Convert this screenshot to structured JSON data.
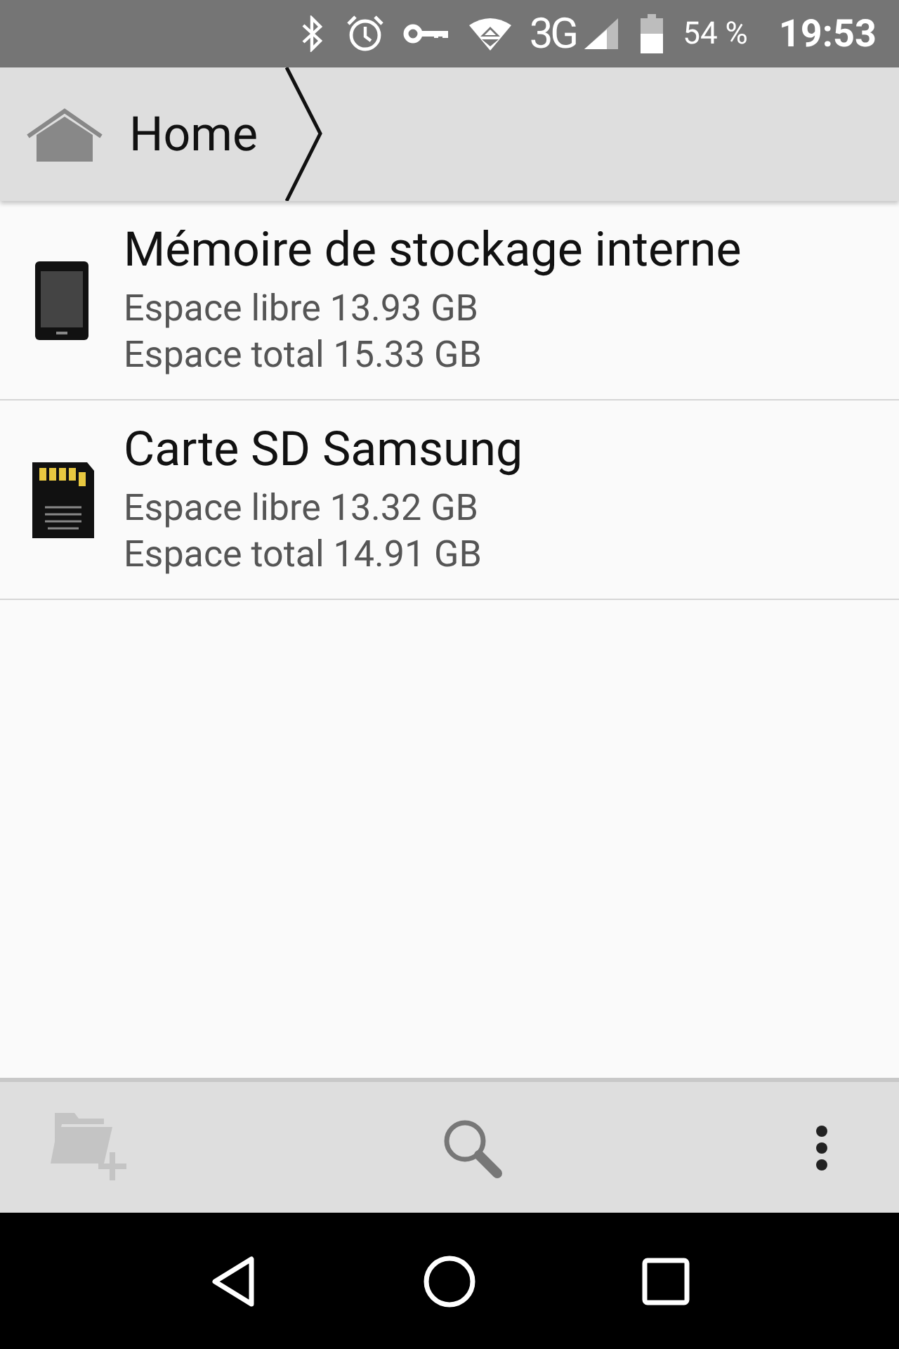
{
  "status_bar": {
    "network": "3G",
    "battery": "54 %",
    "time": "19:53"
  },
  "breadcrumb": {
    "label": "Home"
  },
  "volumes": [
    {
      "kind": "internal",
      "name": "Mémoire de stockage interne",
      "free": "Espace libre 13.93 GB",
      "total": "Espace total 15.33 GB"
    },
    {
      "kind": "sd",
      "name": "Carte SD Samsung",
      "free": "Espace libre 13.32 GB",
      "total": "Espace total 14.91 GB"
    }
  ],
  "toolbar": {
    "new_folder": {
      "disabled": true
    }
  }
}
